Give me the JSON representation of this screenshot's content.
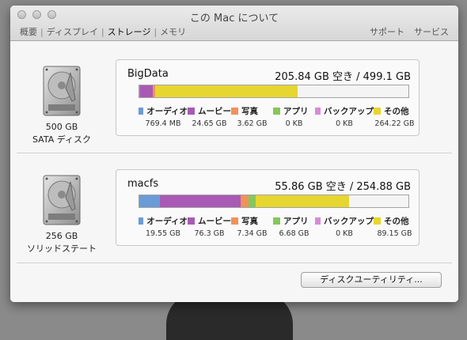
{
  "window": {
    "title": "この Mac について"
  },
  "tabs": [
    {
      "label": "概要"
    },
    {
      "label": "ディスプレイ"
    },
    {
      "label": "ストレージ"
    },
    {
      "label": "メモリ"
    }
  ],
  "links": {
    "support": "サポート",
    "service": "サービス"
  },
  "categories": [
    {
      "label": "オーディオ",
      "color": "#6b9bd7"
    },
    {
      "label": "ムービー",
      "color": "#a85ab5"
    },
    {
      "label": "写真",
      "color": "#f0925a"
    },
    {
      "label": "アプリ",
      "color": "#85c75a"
    },
    {
      "label": "バックアップ",
      "color": "#d98bd5"
    },
    {
      "label": "その他",
      "color": "#e6d630"
    }
  ],
  "disks": [
    {
      "size": "500 GB",
      "type": "SATA ディスク",
      "volume_name": "BigData",
      "capacity": "205.84 GB 空き / 499.1 GB",
      "values": [
        "769.4 MB",
        "24.65 GB",
        "3.62 GB",
        "0 KB",
        "0 KB",
        "264.22 GB"
      ],
      "usage_gb": [
        0.77,
        24.65,
        3.62,
        0,
        0,
        264.22
      ],
      "total_gb": 499.1
    },
    {
      "size": "256 GB",
      "type": "ソリッドステート",
      "volume_name": "macfs",
      "capacity": "55.86 GB 空き / 254.88 GB",
      "values": [
        "19.55 GB",
        "76.3 GB",
        "7.34 GB",
        "6.68 GB",
        "0 KB",
        "89.15 GB"
      ],
      "usage_gb": [
        19.55,
        76.3,
        7.34,
        6.68,
        0,
        89.15
      ],
      "total_gb": 254.88
    }
  ],
  "disk_utility_button": "ディスクユーティリティ..."
}
